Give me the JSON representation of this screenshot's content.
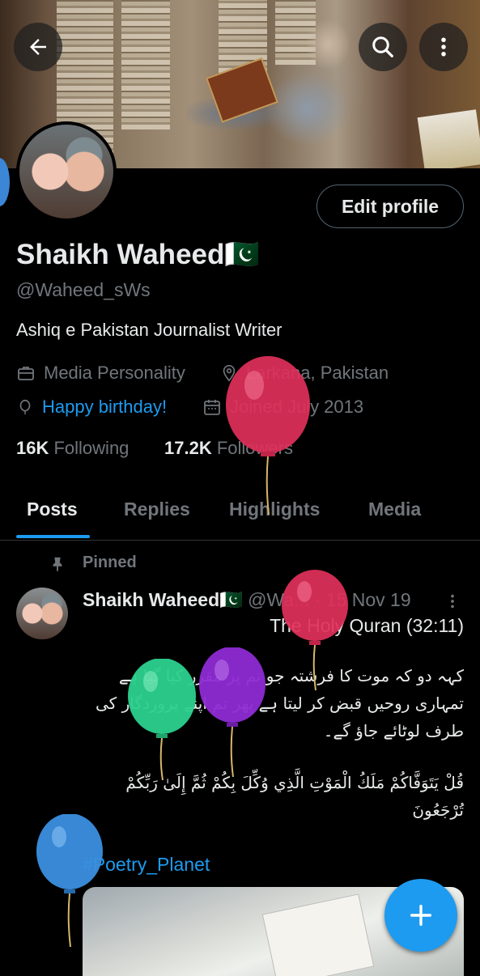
{
  "header": {
    "back_icon": "back-arrow-icon",
    "search_icon": "search-icon",
    "more_icon": "more-vertical-icon"
  },
  "profile": {
    "edit_label": "Edit profile",
    "name": "Shaikh Waheed🇵🇰",
    "handle": "@Waheed_sWs",
    "bio": "Ashiq e Pakistan Journalist Writer",
    "category": "Media Personality",
    "location": "Larkana, Pakistan",
    "birthday": "Happy birthday!",
    "joined": "Joined July 2013",
    "following_count": "16K",
    "following_label": "Following",
    "followers_count": "17.2K",
    "followers_label": "Followers"
  },
  "tabs": [
    {
      "label": "Posts",
      "active": true
    },
    {
      "label": "Replies",
      "active": false
    },
    {
      "label": "Highlights",
      "active": false
    },
    {
      "label": "Media",
      "active": false
    }
  ],
  "post": {
    "pinned_label": "Pinned",
    "author_name": "Shaikh Waheed🇵🇰",
    "author_handle": "@Wa...",
    "date": "· 15 Nov 19",
    "title": "The Holy Quran (32:11)",
    "urdu_text": "کہہ دو کہ موت کا فرشتہ جو تم پر مقرر کیا گیا ہے تمہاری روحیں قبض کر لیتا ہے پھر تم اپنے پروردگار کی طرف لوٹائے جاؤ گے۔",
    "arabic_text": "قُلْ يَتَوَفَّاكُمْ مَلَكُ الْمَوْتِ الَّذِي وُكِّلَ بِكُمْ ثُمَّ إِلَىٰ رَبِّكُمْ تُرْجَعُونَ",
    "hashtag": "#Poetry_Planet"
  },
  "fab": {
    "icon": "plus-icon"
  },
  "colors": {
    "accent": "#1d9bf0",
    "muted": "#71767b",
    "text": "#e7e9ea",
    "background": "#000000",
    "balloon_red": "#e0305a",
    "balloon_green": "#2bd18e",
    "balloon_purple": "#8e2bd4",
    "balloon_blue": "#3b8fe0"
  }
}
